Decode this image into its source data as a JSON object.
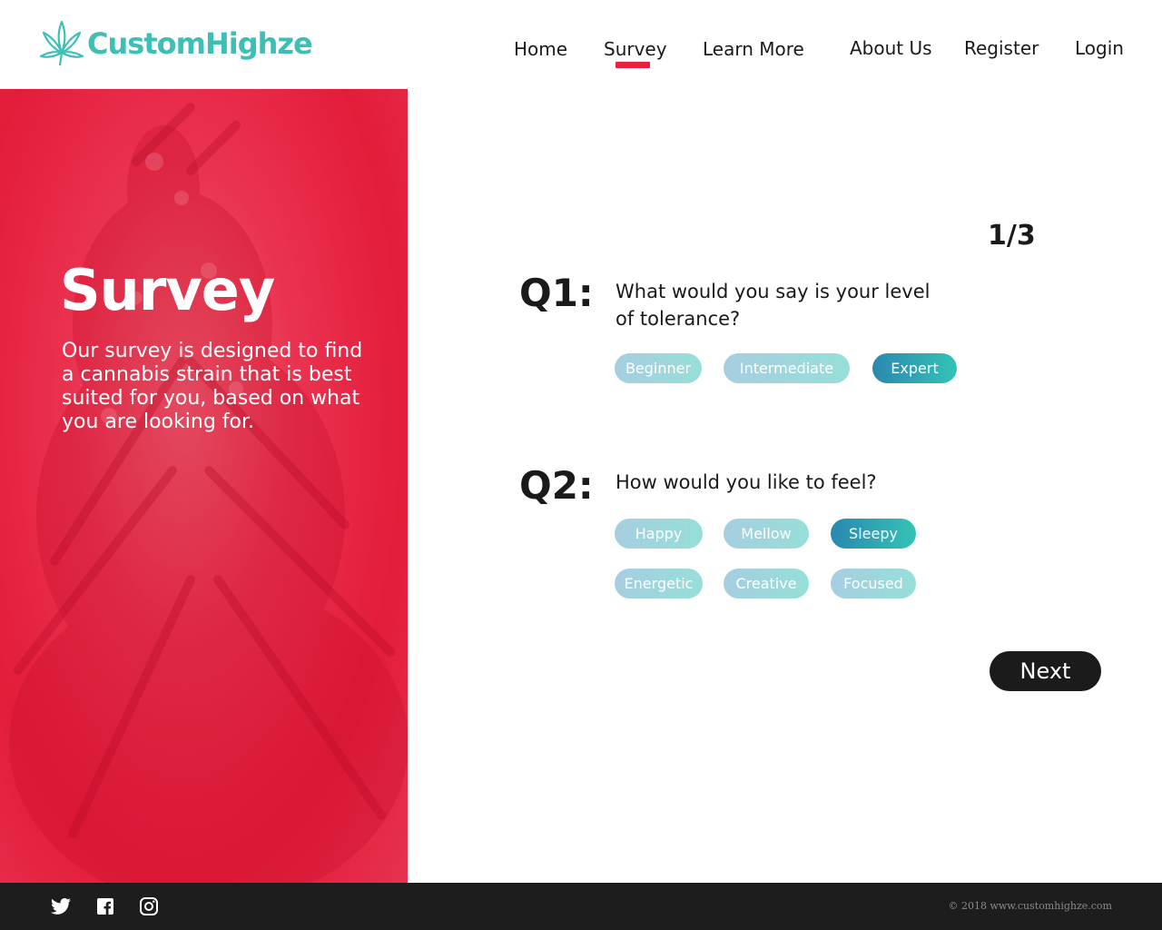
{
  "brand": {
    "name": "CustomHighze",
    "color": "#3dbfb6",
    "logo_icon": "cannabis-leaf-icon"
  },
  "nav": {
    "items": [
      {
        "label": "Home"
      },
      {
        "label": "Survey",
        "active": true
      },
      {
        "label": "Learn More"
      },
      {
        "label": "About Us"
      },
      {
        "label": "Register"
      },
      {
        "label": "Login"
      }
    ],
    "active_color": "#e8213f"
  },
  "hero": {
    "title": "Survey",
    "description": "Our survey is designed to find a cannabis strain that is best suited for you, based on what you are looking for.",
    "accent_color": "#e31c3a"
  },
  "survey": {
    "step": "1/3",
    "questions": [
      {
        "label": "Q1:",
        "text": "What would you say is your level of tolerance?",
        "options": [
          {
            "label": "Beginner",
            "selected": false
          },
          {
            "label": "Intermediate",
            "selected": false
          },
          {
            "label": "Expert",
            "selected": true
          }
        ]
      },
      {
        "label": "Q2:",
        "text": "How would you like to feel?",
        "options": [
          {
            "label": "Happy",
            "selected": false
          },
          {
            "label": "Mellow",
            "selected": false
          },
          {
            "label": "Sleepy",
            "selected": true
          },
          {
            "label": "Energetic",
            "selected": false
          },
          {
            "label": "Creative",
            "selected": false
          },
          {
            "label": "Focused",
            "selected": false
          }
        ]
      }
    ],
    "next_label": "Next"
  },
  "footer": {
    "social": [
      "twitter-icon",
      "facebook-icon",
      "instagram-icon"
    ],
    "copyright": "© 2018 www.customhighze.com"
  }
}
